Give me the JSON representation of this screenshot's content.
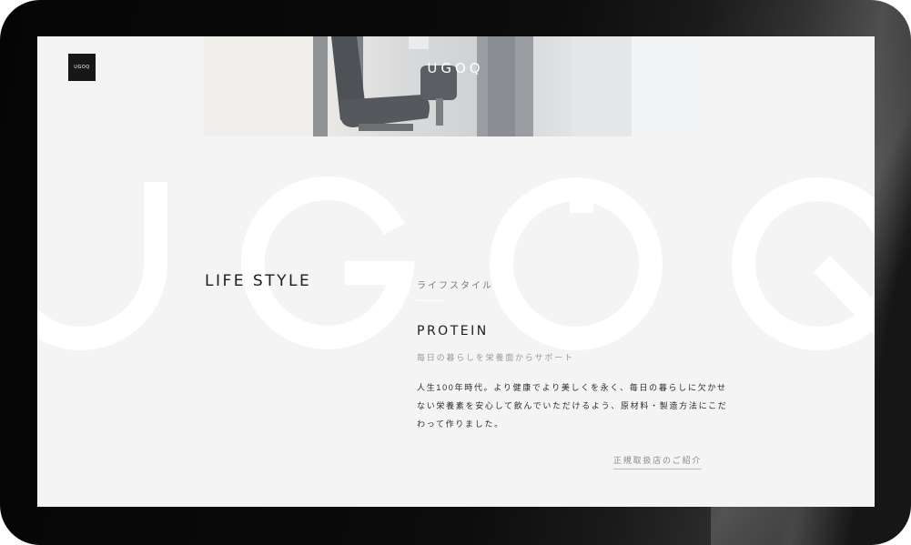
{
  "brand": {
    "logo_small": "UGOQ",
    "logo_hero": "UGOQ"
  },
  "background_letters": "UGOQ",
  "section": {
    "label": "LIFE STYLE",
    "label_jp": "ライフスタイル"
  },
  "product": {
    "title": "PROTEIN",
    "subtitle": "毎日の暮らしを栄養面からサポート",
    "body_lines": [
      "人生100年時代。より健康でより美しくを永く、毎日の暮らしに欠かせ",
      "ない栄養素を安心して飲んでいただけるよう、原材料・製造方法にこだ",
      "わって作りました。"
    ],
    "store_link": "正規取扱店のご紹介"
  },
  "colors": {
    "screen_bg": "#f3f4f3",
    "logo_box": "#171717",
    "text_dark": "#1c1c1c",
    "text_muted": "#9a9a9a"
  }
}
